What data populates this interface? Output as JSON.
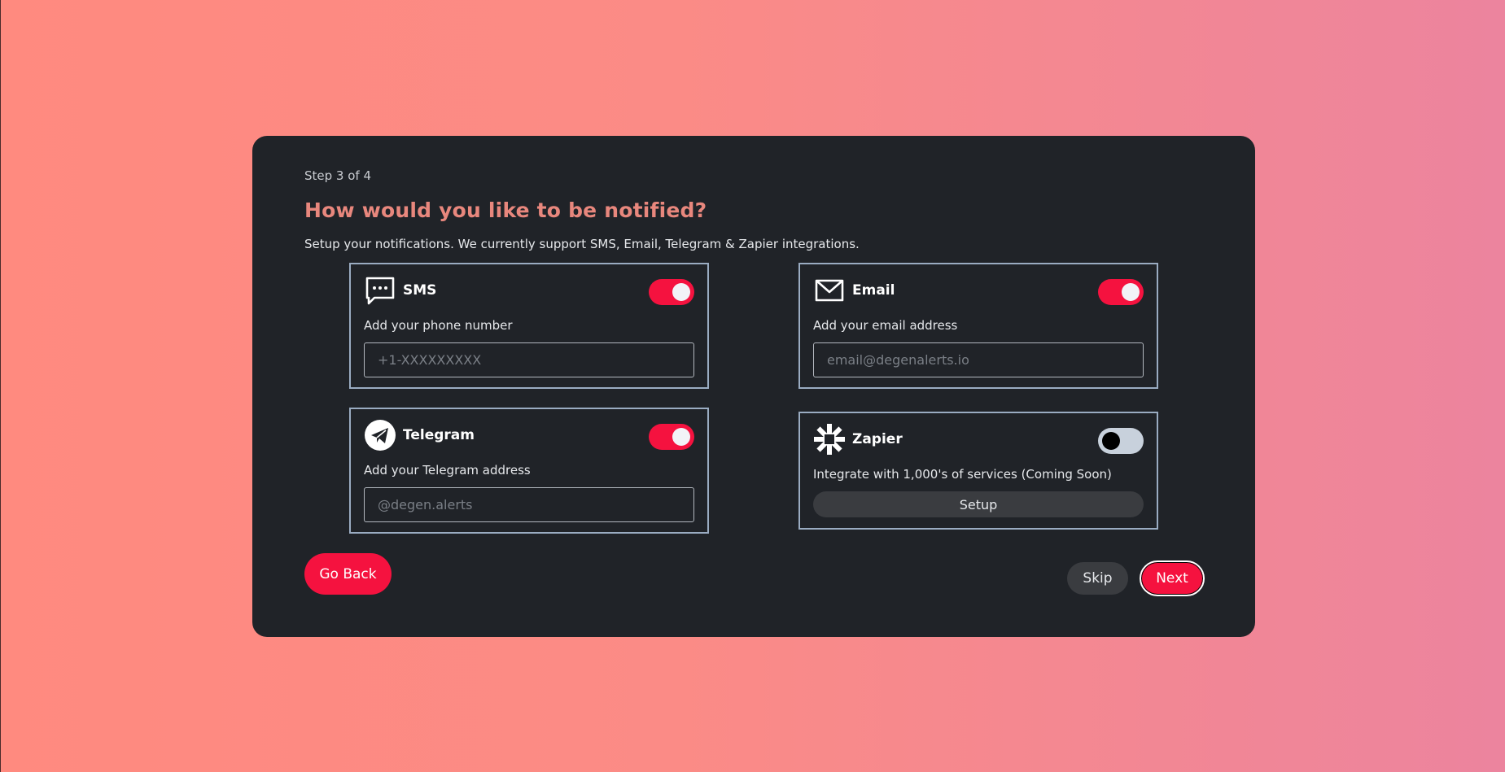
{
  "header": {
    "step": "Step 3 of 4",
    "title": "How would you like to be notified?",
    "subtitle": "Setup your notifications. We currently support SMS, Email, Telegram & Zapier integrations."
  },
  "panels": {
    "sms": {
      "name": "SMS",
      "icon": "chat-bubble-icon",
      "enabled": true,
      "label": "Add your phone number",
      "placeholder": "+1-XXXXXXXXX",
      "value": ""
    },
    "email": {
      "name": "Email",
      "icon": "envelope-icon",
      "enabled": true,
      "label": "Add your email address",
      "placeholder": "email@degenalerts.io",
      "value": ""
    },
    "telegram": {
      "name": "Telegram",
      "icon": "telegram-icon",
      "enabled": true,
      "label": "Add your Telegram address",
      "placeholder": "@degen.alerts",
      "value": ""
    },
    "zapier": {
      "name": "Zapier",
      "icon": "zapier-asterisk-icon",
      "enabled": false,
      "label": "Integrate with 1,000's of services (Coming Soon)",
      "setup_label": "Setup"
    }
  },
  "footer": {
    "back_label": "Go Back",
    "skip_label": "Skip",
    "next_label": "Next"
  },
  "colors": {
    "accent": "#f5123f",
    "title": "#e8877d",
    "card": "#202328",
    "panel_border": "#9aacc2"
  }
}
